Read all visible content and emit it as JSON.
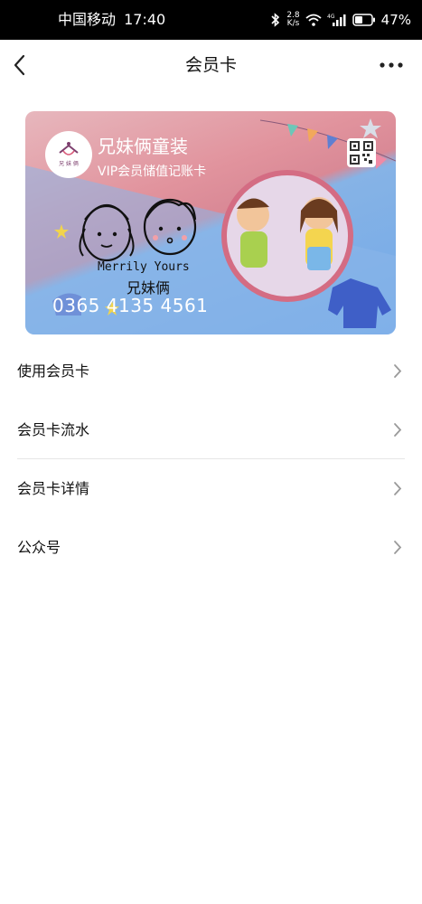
{
  "status_bar": {
    "carrier": "中国移动",
    "time": "17:40",
    "net_speed_value": "2.8",
    "net_speed_unit": "K/s",
    "signal_label": "4G",
    "battery_percent": "47%",
    "battery_level": 0.47
  },
  "nav": {
    "title": "会员卡"
  },
  "card": {
    "brand_name": "兄妹俩童装",
    "subtitle": "VIP会员储值记账卡",
    "art_text_en": "Merrily Yours",
    "art_text_cn": "兄妹俩",
    "card_number": "0365 4135 4561",
    "logo_text": "兄 妹 俩"
  },
  "menu": {
    "items": [
      {
        "label": "使用会员卡"
      },
      {
        "label": "会员卡流水"
      },
      {
        "label": "会员卡详情"
      },
      {
        "label": "公众号"
      }
    ]
  }
}
